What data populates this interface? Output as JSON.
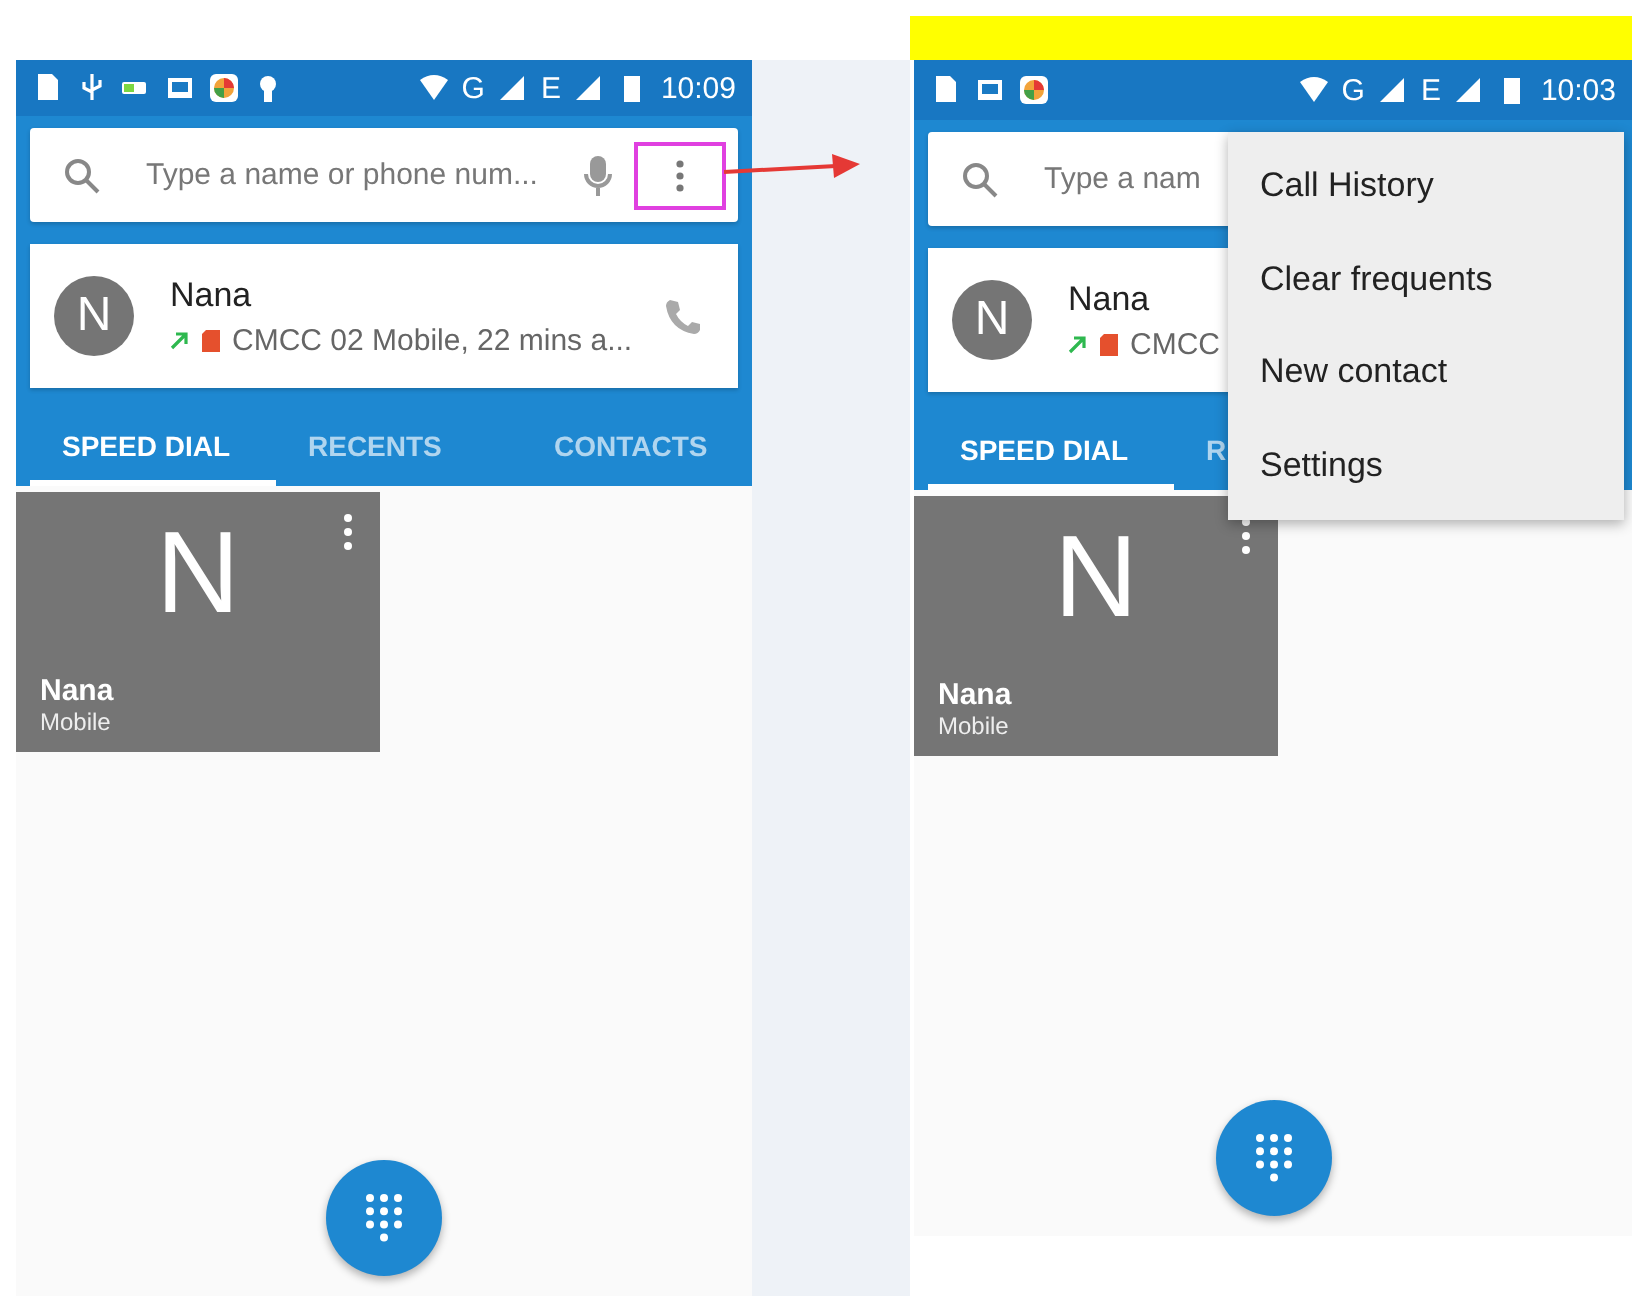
{
  "screens": [
    {
      "status_bar": {
        "network_labels": [
          "G",
          "E"
        ],
        "time": "10:09"
      },
      "search": {
        "placeholder": "Type a name or phone num...",
        "more_highlighted": true
      },
      "recent": {
        "avatar": "N",
        "name": "Nana",
        "detail": "CMCC 02 Mobile, 22 mins a..."
      },
      "tabs": [
        {
          "label": "SPEED DIAL",
          "selected": true
        },
        {
          "label": "RECENTS",
          "selected": false
        },
        {
          "label": "CONTACTS",
          "selected": false
        }
      ],
      "tile": {
        "letter": "N",
        "name": "Nana",
        "label": "Mobile"
      }
    },
    {
      "status_bar": {
        "network_labels": [
          "G",
          "E"
        ],
        "time": "10:03"
      },
      "search": {
        "placeholder": "Type a nam"
      },
      "recent": {
        "avatar": "N",
        "name": "Nana",
        "detail": "CMCC"
      },
      "tabs": [
        {
          "label": "SPEED DIAL",
          "selected": true
        },
        {
          "label": "R",
          "selected": false
        }
      ],
      "tile": {
        "letter": "N",
        "name": "Nana",
        "label": "Mobile"
      },
      "menu": [
        "Call History",
        "Clear frequents",
        "New contact",
        "Settings"
      ]
    }
  ]
}
